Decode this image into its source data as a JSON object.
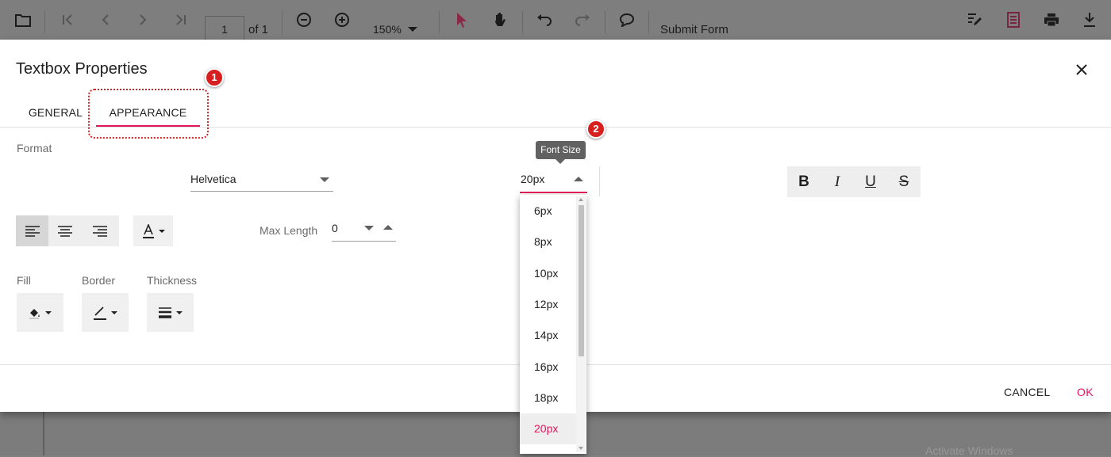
{
  "toolbar": {
    "page_number": "1",
    "page_of": "of 1",
    "zoom": "150%",
    "submit_form": "Submit Form"
  },
  "dialog": {
    "title": "Textbox Properties",
    "tabs": [
      {
        "label": "GENERAL",
        "active": false
      },
      {
        "label": "APPEARANCE",
        "active": true
      }
    ],
    "callouts": [
      "1",
      "2"
    ],
    "format_label": "Format",
    "font_family": "Helvetica",
    "font_size": "20px",
    "font_size_tooltip": "Font Size",
    "font_size_options": [
      "6px",
      "8px",
      "10px",
      "12px",
      "14px",
      "16px",
      "18px",
      "20px"
    ],
    "font_size_selected": "20px",
    "style_buttons": [
      "B",
      "I",
      "U",
      "S"
    ],
    "max_length_label": "Max Length",
    "max_length_value": "0",
    "fill_label": "Fill",
    "border_label": "Border",
    "thickness_label": "Thickness",
    "cancel_label": "CANCEL",
    "ok_label": "OK"
  },
  "watermark": "Activate Windows",
  "colors": {
    "accent": "#e3165b",
    "callout": "#d71f1f",
    "overlay": "#7f7f7f"
  }
}
